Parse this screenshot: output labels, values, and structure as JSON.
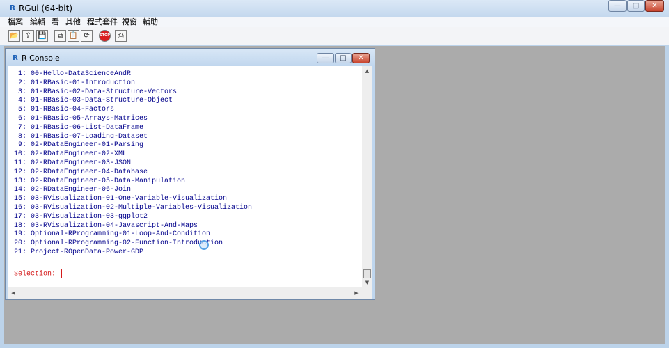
{
  "app": {
    "title": "RGui (64-bit)",
    "logo_letter": "R"
  },
  "window_buttons": {
    "minimize": "—",
    "maximize": "□",
    "close": "✕"
  },
  "menu": [
    "檔案",
    "編輯",
    "看",
    "其他",
    "程式套件",
    "視窗",
    "輔助"
  ],
  "toolbar": {
    "tools": [
      {
        "name": "open-script",
        "icon": "folder-open-icon",
        "glyph": "📂"
      },
      {
        "name": "load-workspace",
        "icon": "load-icon",
        "glyph": "⇪"
      },
      {
        "name": "save-workspace",
        "icon": "floppy-icon",
        "glyph": "💾"
      },
      {
        "name": "copy",
        "icon": "copy-icon",
        "glyph": "⧉"
      },
      {
        "name": "paste",
        "icon": "paste-icon",
        "glyph": "📋"
      },
      {
        "name": "copy-paste",
        "icon": "refresh-icon",
        "glyph": "⟳"
      },
      {
        "name": "stop",
        "icon": "stop-icon",
        "glyph": "STOP"
      },
      {
        "name": "print",
        "icon": "print-icon",
        "glyph": "⎙"
      }
    ]
  },
  "console": {
    "title": "R Console",
    "lines": [
      " 1: 00-Hello-DataScienceAndR",
      " 2: 01-RBasic-01-Introduction",
      " 3: 01-RBasic-02-Data-Structure-Vectors",
      " 4: 01-RBasic-03-Data-Structure-Object",
      " 5: 01-RBasic-04-Factors",
      " 6: 01-RBasic-05-Arrays-Matrices",
      " 7: 01-RBasic-06-List-DataFrame",
      " 8: 01-RBasic-07-Loading-Dataset",
      " 9: 02-RDataEngineer-01-Parsing",
      "10: 02-RDataEngineer-02-XML",
      "11: 02-RDataEngineer-03-JSON",
      "12: 02-RDataEngineer-04-Database",
      "13: 02-RDataEngineer-05-Data-Manipulation",
      "14: 02-RDataEngineer-06-Join",
      "15: 03-RVisualization-01-One-Variable-Visualization",
      "16: 03-RVisualization-02-Multiple-Variables-Visualization",
      "17: 03-RVisualization-03-ggplot2",
      "18: 03-RVisualization-04-Javascript-And-Maps",
      "19: Optional-RProgramming-01-Loop-And-Condition",
      "20: Optional-RProgramming-02-Function-Introduction",
      "21: Project-ROpenData-Power-GDP"
    ],
    "prompt": "Selection: "
  },
  "colors": {
    "output_text": "#00008b",
    "prompt_text": "#d51b1b",
    "mdi_background": "#ababab"
  }
}
